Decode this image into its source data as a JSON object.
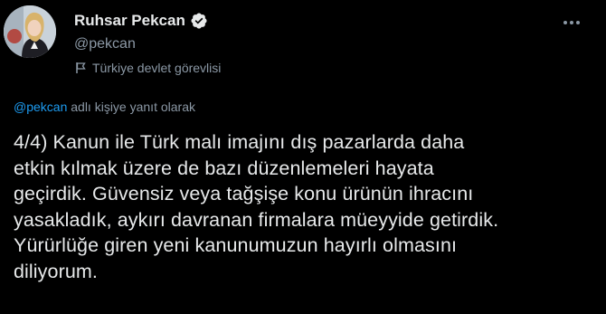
{
  "author": {
    "display_name": "Ruhsar Pekcan",
    "handle": "@pekcan",
    "label": "Türkiye devlet görevlisi",
    "avatar_icon": "profile-photo",
    "verified_icon": "verified-badge-icon"
  },
  "reply": {
    "mention": "@pekcan",
    "suffix": " adlı kişiye yanıt olarak"
  },
  "tweet": {
    "lines": [
      "4/4) Kanun ile Türk malı imajını dış pazarlarda daha",
      "etkin kılmak üzere de bazı düzenlemeleri hayata",
      "geçirdik. Güvensiz veya tağşişe konu ürünün ihracını",
      "yasakladık, aykırı davranan firmalara müeyyide getirdik.",
      "Yürürlüğe giren yeni kanunumuzun hayırlı olmasını",
      "diliyorum."
    ]
  },
  "colors": {
    "background": "#000000",
    "text": "#e7e9ea",
    "secondary": "#8b98a5",
    "link": "#1d9bf0"
  }
}
